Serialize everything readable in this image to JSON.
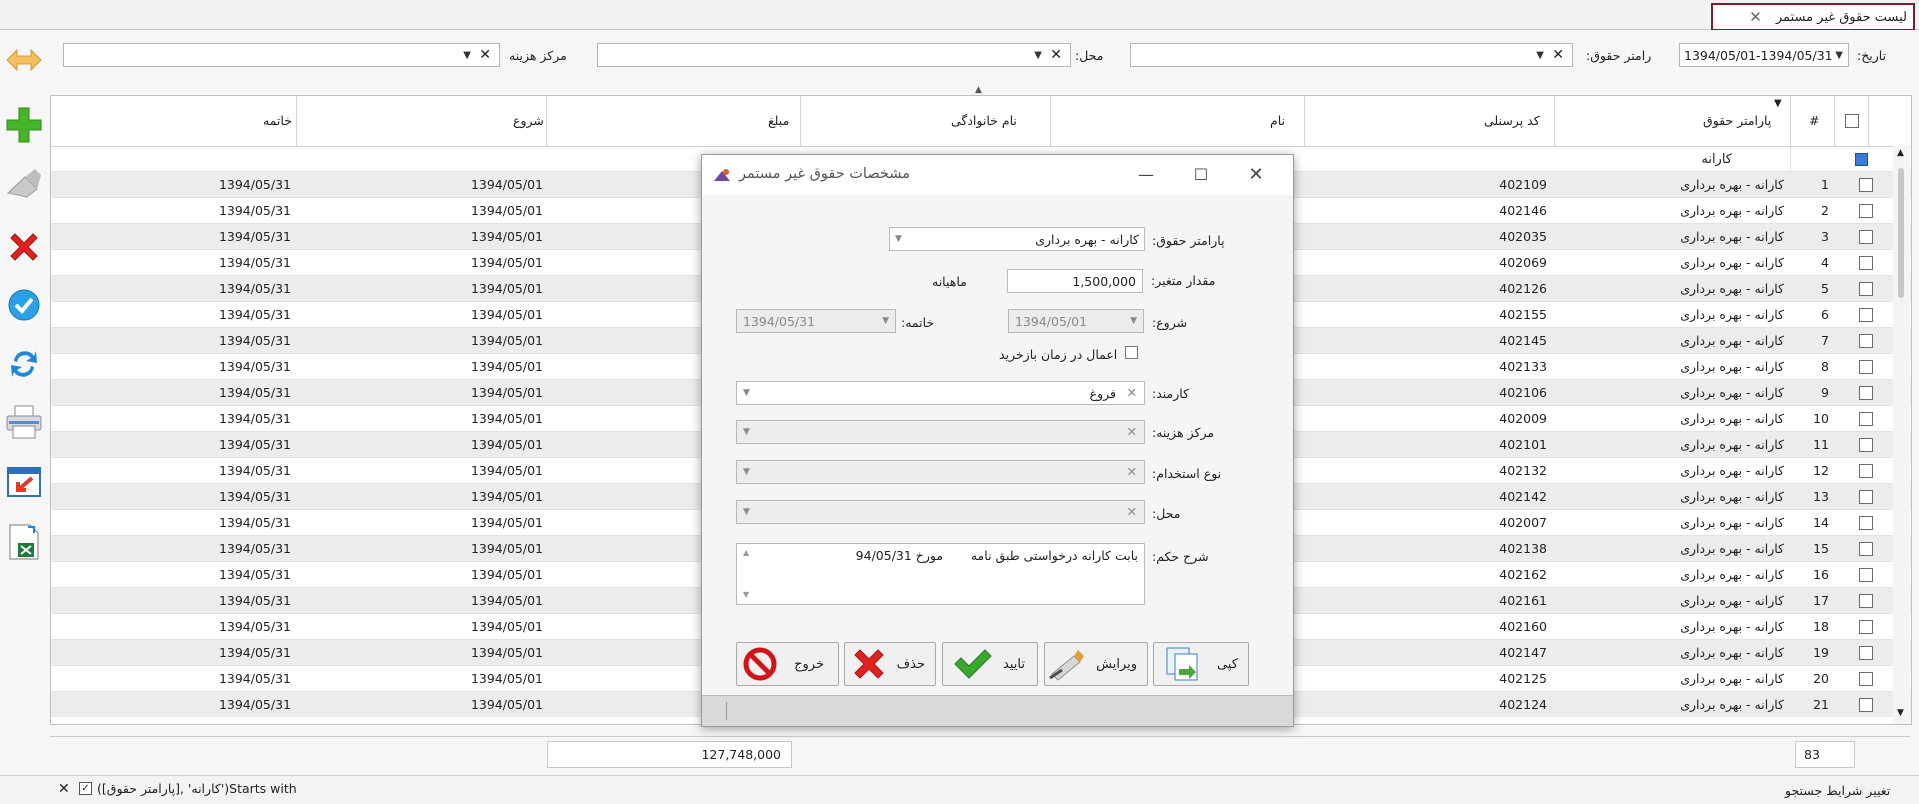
{
  "tab": {
    "title": "لیست حقوق غیر مستمر",
    "close": "✕"
  },
  "filters": {
    "date_label": "تاریخ:",
    "date_value": "1394/05/01-1394/05/31",
    "param_label": "رامتر حقوق:",
    "location_label": "محل:",
    "cost_center_label": "مرکز هزینه"
  },
  "grid": {
    "columns": {
      "num": "#",
      "param": "پارامتر حقوق",
      "code": "کد پرسنلی",
      "first_name": "نام",
      "last_name": "نام خانوادگی",
      "amount": "مبلغ",
      "start": "شروع",
      "end": "خاتمه"
    },
    "filter_value": "کارانه",
    "rows": [
      {
        "n": "1",
        "param": "کارانه - بهره برداری",
        "code": "402109",
        "start": "1394/05/01",
        "end": "1394/05/31"
      },
      {
        "n": "2",
        "param": "کارانه - بهره برداری",
        "code": "402146",
        "start": "1394/05/01",
        "end": "1394/05/31"
      },
      {
        "n": "3",
        "param": "کارانه - بهره برداری",
        "code": "402035",
        "start": "1394/05/01",
        "end": "1394/05/31"
      },
      {
        "n": "4",
        "param": "کارانه - بهره برداری",
        "code": "402069",
        "start": "1394/05/01",
        "end": "1394/05/31"
      },
      {
        "n": "5",
        "param": "کارانه - بهره برداری",
        "code": "402126",
        "start": "1394/05/01",
        "end": "1394/05/31"
      },
      {
        "n": "6",
        "param": "کارانه - بهره برداری",
        "code": "402155",
        "start": "1394/05/01",
        "end": "1394/05/31"
      },
      {
        "n": "7",
        "param": "کارانه - بهره برداری",
        "code": "402145",
        "start": "1394/05/01",
        "end": "1394/05/31"
      },
      {
        "n": "8",
        "param": "کارانه - بهره برداری",
        "code": "402133",
        "start": "1394/05/01",
        "end": "1394/05/31"
      },
      {
        "n": "9",
        "param": "کارانه - بهره برداری",
        "code": "402106",
        "start": "1394/05/01",
        "end": "1394/05/31"
      },
      {
        "n": "10",
        "param": "کارانه - بهره برداری",
        "code": "402009",
        "start": "1394/05/01",
        "end": "1394/05/31"
      },
      {
        "n": "11",
        "param": "کارانه - بهره برداری",
        "code": "402101",
        "start": "1394/05/01",
        "end": "1394/05/31"
      },
      {
        "n": "12",
        "param": "کارانه - بهره برداری",
        "code": "402132",
        "start": "1394/05/01",
        "end": "1394/05/31"
      },
      {
        "n": "13",
        "param": "کارانه - بهره برداری",
        "code": "402142",
        "start": "1394/05/01",
        "end": "1394/05/31"
      },
      {
        "n": "14",
        "param": "کارانه - بهره برداری",
        "code": "402007",
        "start": "1394/05/01",
        "end": "1394/05/31"
      },
      {
        "n": "15",
        "param": "کارانه - بهره برداری",
        "code": "402138",
        "start": "1394/05/01",
        "end": "1394/05/31"
      },
      {
        "n": "16",
        "param": "کارانه - بهره برداری",
        "code": "402162",
        "start": "1394/05/01",
        "end": "1394/05/31"
      },
      {
        "n": "17",
        "param": "کارانه - بهره برداری",
        "code": "402161",
        "start": "1394/05/01",
        "end": "1394/05/31"
      },
      {
        "n": "18",
        "param": "کارانه - بهره برداری",
        "code": "402160",
        "start": "1394/05/01",
        "end": "1394/05/31"
      },
      {
        "n": "19",
        "param": "کارانه - بهره برداری",
        "code": "402147",
        "start": "1394/05/01",
        "end": "1394/05/31"
      },
      {
        "n": "20",
        "param": "کارانه - بهره برداری",
        "code": "402125",
        "start": "1394/05/01",
        "end": "1394/05/31"
      },
      {
        "n": "21",
        "param": "کارانه - بهره برداری",
        "code": "402124",
        "start": "1394/05/01",
        "end": "1394/05/31"
      }
    ],
    "count_total": "83",
    "amount_total": "127,748,000"
  },
  "statusbar": {
    "filter_text": "([پارامتر حقوق], 'کارانه')Starts with",
    "change_search": "تغییر شرایط جستجو"
  },
  "dialog": {
    "title": "مشخصات حقوق غیر مستمر",
    "param_label": "پارامتر حقوق:",
    "param_value": "کارانه - بهره برداری",
    "var_amount_label": "مقدار متغیر:",
    "var_amount_value": "1,500,000",
    "unit": "ماهیانه",
    "start_label": "شروع:",
    "start_value": "1394/05/01",
    "end_label": "خاتمه:",
    "end_value": "1394/05/31",
    "apply_label": "اعمال در زمان بازخرید",
    "employee_label": "کارمند:",
    "employee_value": "فروغ",
    "cost_center_label": "مرکز هزینه:",
    "employment_type_label": "نوع استخدام:",
    "location_label": "محل:",
    "description_label": "شرح حکم:",
    "description_value": "بابت کارانه درخواستی طبق نامه       مورخ 94/05/31",
    "buttons": {
      "copy": "کپی",
      "edit": "ویرایش",
      "confirm": "تایید",
      "delete": "حذف",
      "exit": "خروج"
    }
  }
}
